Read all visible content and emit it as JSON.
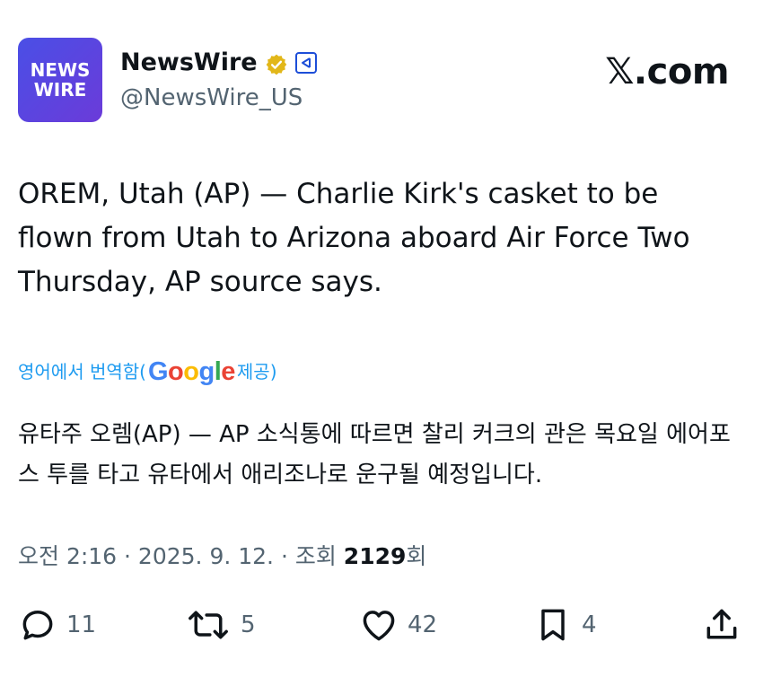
{
  "author": {
    "avatar_line1": "NEWS",
    "avatar_line2": "WIRE",
    "display_name": "NewsWire",
    "handle": "@NewsWire_US",
    "verified_icon": "verified-gold-badge",
    "affiliation_icon": "org-affiliate-badge"
  },
  "brand": {
    "label": "𝕏.com"
  },
  "tweet": {
    "text": "OREM, Utah (AP) — Charlie Kirk's casket to be flown from Utah to Arizona aboard Air Force Two Thursday, AP source says."
  },
  "translation": {
    "prefix": "영어에서 번역함(",
    "google_letters": [
      "G",
      "o",
      "o",
      "g",
      "l",
      "e"
    ],
    "suffix": " 제공)",
    "text": "유타주 오렘(AP) — AP 소식통에 따르면 찰리 커크의 관은 목요일 에어포스 투를 타고 유타에서 애리조나로 운구될 예정입니다."
  },
  "meta": {
    "time_date": "오전 2:16 · 2025. 9. 12. · 조회 ",
    "views": "2129",
    "views_suffix": "회"
  },
  "actions": {
    "replies": "11",
    "reposts": "5",
    "likes": "42",
    "bookmarks": "4"
  },
  "colors": {
    "text": "#0f1419",
    "muted": "#536471",
    "link": "#1d9bf0",
    "verified_gold": "#e2b719"
  }
}
